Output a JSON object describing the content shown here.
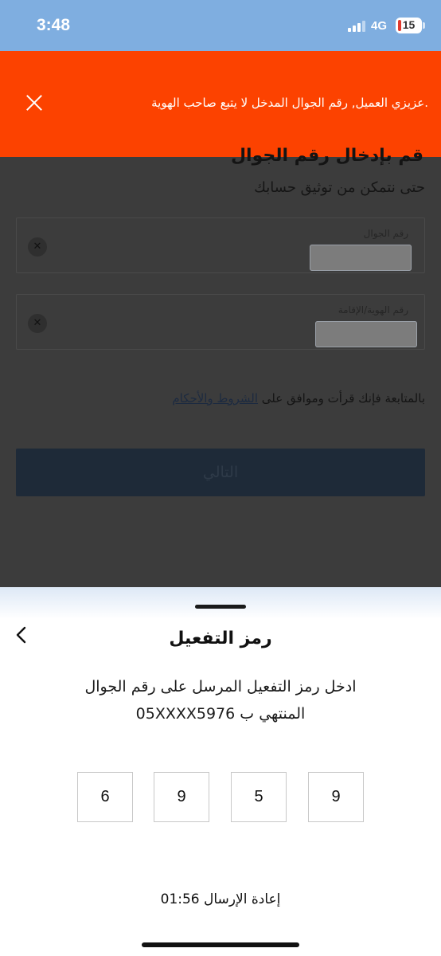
{
  "status_bar": {
    "time": "3:48",
    "network": "4G",
    "battery": "15"
  },
  "alert": {
    "message": ".عزيزي العميل, رقم الجوال المدخل لا يتبع صاحب الهوية",
    "close_icon": "close-icon",
    "color": "#fc4200"
  },
  "background_form": {
    "subtitle": "حتى نتمكن من توثيق حسابك",
    "fields": [
      {
        "label": "رقم الجوال"
      },
      {
        "label": "رقم الهوية/الإقامة"
      }
    ],
    "terms_prefix": "بالمتابعة فإنك قرأت وموافق على",
    "terms_link": "الشروط والأحكام",
    "next_button": "التالي"
  },
  "sheet": {
    "title": "رمز التفعيل",
    "description_line1": "ادخل رمز التفعيل المرسل على رقم الجوال",
    "description_line2": "المنتهي ب 05XXXX5976",
    "otp_digits": [
      "6",
      "9",
      "5",
      "9"
    ],
    "resend": "إعادة الإرسال 01:56",
    "back_icon": "chevron-left-icon"
  }
}
